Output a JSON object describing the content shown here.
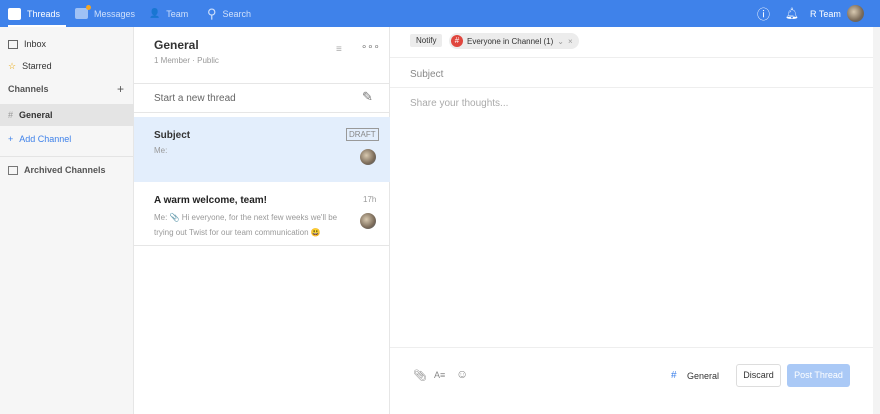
{
  "topbar": {
    "tabs": [
      "Threads",
      "Messages",
      "Team",
      "Search"
    ],
    "user": "R Team"
  },
  "sidebar": {
    "inbox": "Inbox",
    "starred": "Starred",
    "channels_heading": "Channels",
    "channel": "General",
    "add_channel": "Add Channel",
    "archived": "Archived Channels"
  },
  "channel": {
    "title": "General",
    "meta": "1 Member · Public",
    "new_thread": "Start a new thread"
  },
  "threads": [
    {
      "title": "Subject",
      "preview": "Me:",
      "badge": "DRAFT"
    },
    {
      "title": "A warm welcome, team!",
      "preview": "Me: 📎 Hi everyone, for the next few weeks we'll be trying out Twist for our team communication 😃",
      "time": "17h"
    }
  ],
  "composer": {
    "notify": "Notify",
    "recipient": "Everyone in Channel (1)",
    "subject_placeholder": "Subject",
    "body_placeholder": "Share your thoughts...",
    "channel": "General",
    "discard": "Discard",
    "post": "Post Thread"
  },
  "colors": {
    "brand": "#3f82ea",
    "selected": "#e3eefc"
  }
}
